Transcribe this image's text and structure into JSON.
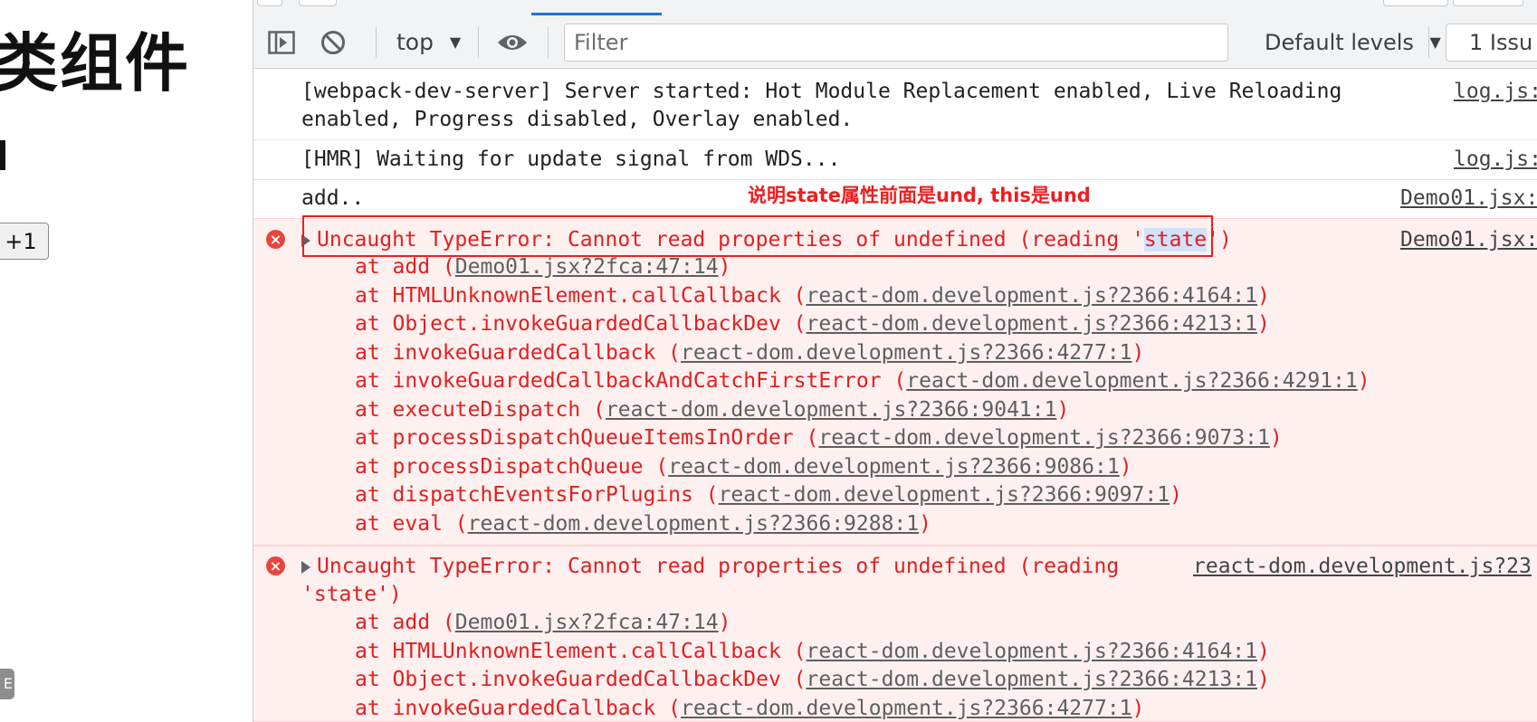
{
  "page": {
    "title": "类组件",
    "increment_button": "+1",
    "chip_text": "E"
  },
  "devtools": {
    "toolbar": {
      "context": "top",
      "filter_placeholder": "Filter",
      "levels": "Default levels",
      "issues": "1 Issu"
    },
    "messages": [
      {
        "type": "log",
        "text": "[webpack-dev-server] Server started: Hot Module Replacement enabled, Live Reloading\nenabled, Progress disabled, Overlay enabled.",
        "source": "log.js:"
      },
      {
        "type": "log",
        "text": "[HMR] Waiting for update signal from WDS...",
        "source": "log.js:"
      },
      {
        "type": "log",
        "text": "add..",
        "source": "Demo01.jsx:"
      }
    ],
    "error1": {
      "prefix": "Uncaught TypeError: Cannot read properties of undefined (reading '",
      "highlight": "state",
      "suffix": "')",
      "source": "Demo01.jsx:"
    },
    "stack1": [
      {
        "fn": "at add (",
        "link": "Demo01.jsx?2fca:47:14",
        "end": ")"
      },
      {
        "fn": "at HTMLUnknownElement.callCallback (",
        "link": "react-dom.development.js?2366:4164:1",
        "end": ")"
      },
      {
        "fn": "at Object.invokeGuardedCallbackDev (",
        "link": "react-dom.development.js?2366:4213:1",
        "end": ")"
      },
      {
        "fn": "at invokeGuardedCallback (",
        "link": "react-dom.development.js?2366:4277:1",
        "end": ")"
      },
      {
        "fn": "at invokeGuardedCallbackAndCatchFirstError (",
        "link": "react-dom.development.js?2366:4291:1",
        "end": ")"
      },
      {
        "fn": "at executeDispatch (",
        "link": "react-dom.development.js?2366:9041:1",
        "end": ")"
      },
      {
        "fn": "at processDispatchQueueItemsInOrder (",
        "link": "react-dom.development.js?2366:9073:1",
        "end": ")"
      },
      {
        "fn": "at processDispatchQueue (",
        "link": "react-dom.development.js?2366:9086:1",
        "end": ")"
      },
      {
        "fn": "at dispatchEventsForPlugins (",
        "link": "react-dom.development.js?2366:9097:1",
        "end": ")"
      },
      {
        "fn": "at eval (",
        "link": "react-dom.development.js?2366:9288:1",
        "end": ")"
      }
    ],
    "error2": {
      "line1": "Uncaught TypeError: Cannot read properties of undefined (reading",
      "line2": "'state')",
      "source": "react-dom.development.js?23"
    },
    "stack2": [
      {
        "fn": "at add (",
        "link": "Demo01.jsx?2fca:47:14",
        "end": ")"
      },
      {
        "fn": "at HTMLUnknownElement.callCallback (",
        "link": "react-dom.development.js?2366:4164:1",
        "end": ")"
      },
      {
        "fn": "at Object.invokeGuardedCallbackDev (",
        "link": "react-dom.development.js?2366:4213:1",
        "end": ")"
      },
      {
        "fn": "at invokeGuardedCallback (",
        "link": "react-dom.development.js?2366:4277:1",
        "end": ")"
      }
    ]
  },
  "annotation": {
    "text": "说明state属性前面是und, this是und",
    "color": "#ee1e1e"
  },
  "colors": {
    "error_text": "#e02020",
    "error_bg": "#fff0f0",
    "accent": "#1a73e8"
  }
}
